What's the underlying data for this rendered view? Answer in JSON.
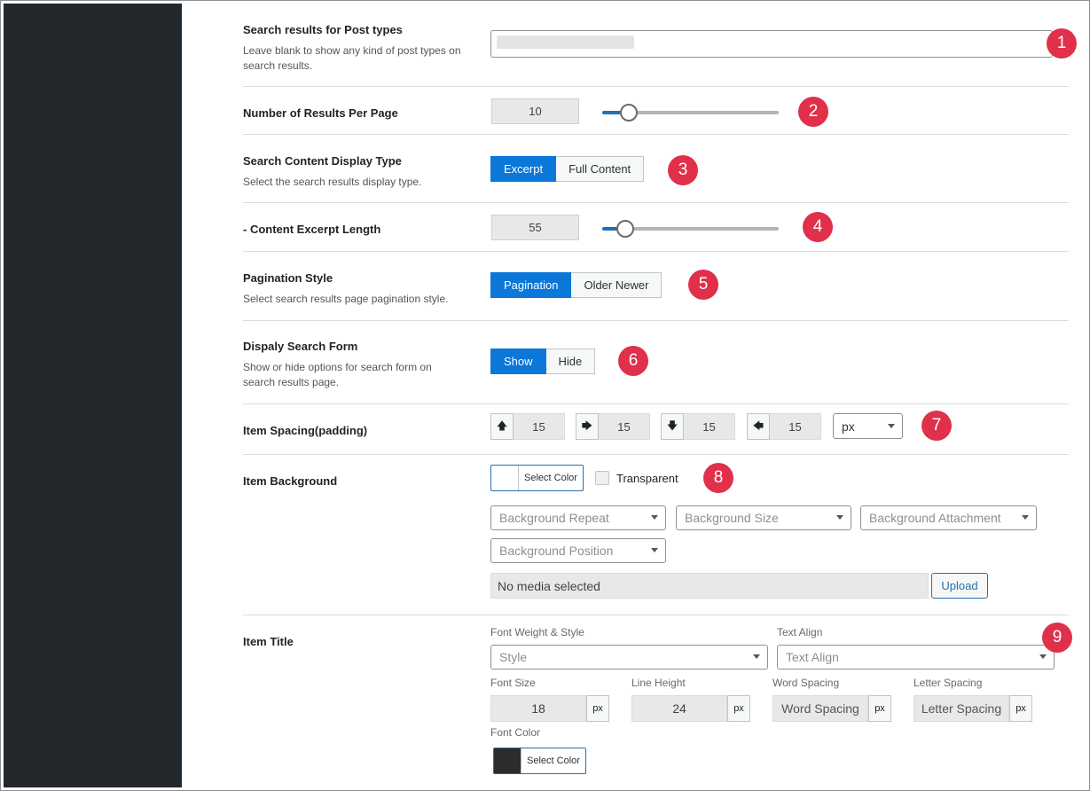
{
  "rows": {
    "post_types": {
      "label": "Search results for Post types",
      "desc": "Leave blank to show any kind of post types on search results.",
      "badge": "1"
    },
    "results_per_page": {
      "label": "Number of Results Per Page",
      "value": "10",
      "slider_fraction": 0.15,
      "badge": "2"
    },
    "content_display": {
      "label": "Search Content Display Type",
      "desc": "Select the search results display type.",
      "options": [
        "Excerpt",
        "Full Content"
      ],
      "selected": "Excerpt",
      "badge": "3"
    },
    "excerpt_length": {
      "label": "- Content Excerpt Length",
      "value": "55",
      "slider_fraction": 0.13,
      "badge": "4"
    },
    "pagination": {
      "label": "Pagination Style",
      "desc": "Select search results page pagination style.",
      "options": [
        "Pagination",
        "Older Newer"
      ],
      "selected": "Pagination",
      "badge": "5"
    },
    "search_form": {
      "label": "Dispaly Search Form",
      "desc": "Show or hide options for search form on search results page.",
      "options": [
        "Show",
        "Hide"
      ],
      "selected": "Show",
      "badge": "6"
    },
    "item_spacing": {
      "label": "Item Spacing(padding)",
      "top": "15",
      "right": "15",
      "bottom": "15",
      "left": "15",
      "unit": "px",
      "badge": "7"
    },
    "item_background": {
      "label": "Item Background",
      "color_label": "Select Color",
      "transparent_label": "Transparent",
      "repeat": "Background Repeat",
      "size": "Background Size",
      "attachment": "Background Attachment",
      "position": "Background Position",
      "media": "No media selected",
      "upload": "Upload",
      "badge": "8"
    },
    "item_title": {
      "label": "Item Title",
      "font_weight_label": "Font Weight & Style",
      "font_weight_value": "Style",
      "text_align_label": "Text Align",
      "text_align_value": "Text Align",
      "font_size_label": "Font Size",
      "font_size_value": "18",
      "line_height_label": "Line Height",
      "line_height_value": "24",
      "word_spacing_label": "Word Spacing",
      "word_spacing_value": "Word Spacing",
      "letter_spacing_label": "Letter Spacing",
      "letter_spacing_value": "Letter Spacing",
      "unit": "px",
      "font_color_label": "Font Color",
      "font_color_button": "Select Color",
      "font_color": "#2c2c2c",
      "badge": "9"
    }
  },
  "colors": {
    "accent": "#0a77d9",
    "badge": "#e0304a",
    "sidebar": "#23282d"
  }
}
